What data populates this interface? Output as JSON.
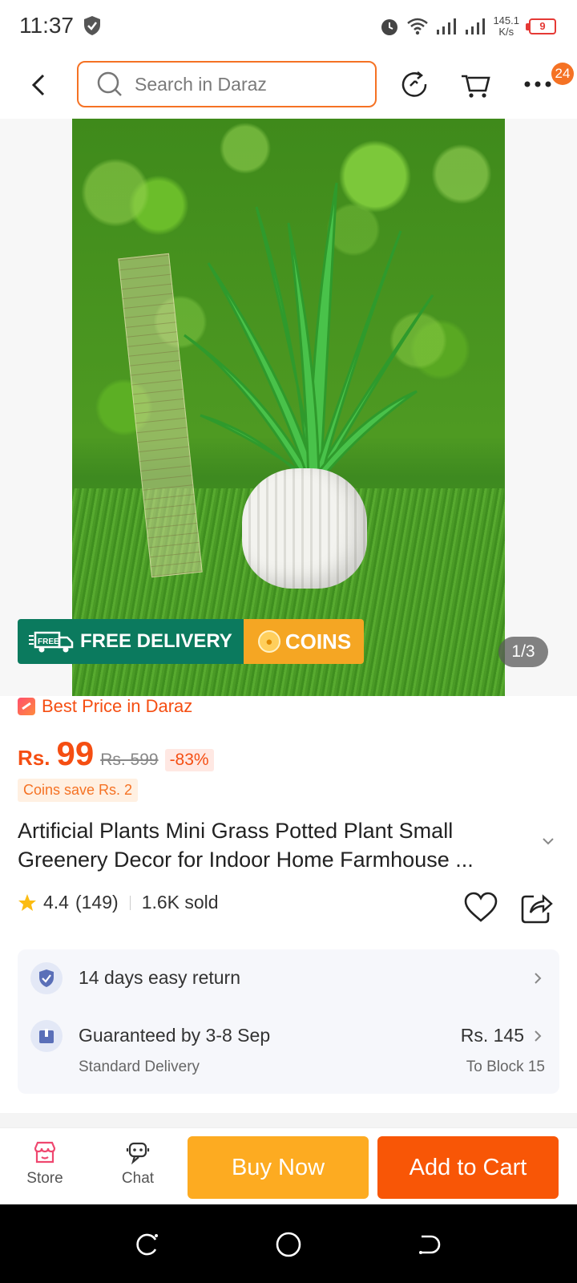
{
  "status_bar": {
    "time": "11:37",
    "net_speed_value": "145.1",
    "net_speed_unit": "K/s",
    "battery": "9"
  },
  "header": {
    "search_placeholder": "Search in Daraz",
    "more_badge": "24"
  },
  "gallery": {
    "badge_free_delivery": "FREE DELIVERY",
    "badge_free_tag": "FREE",
    "badge_coins": "COINS",
    "pager": "1/3"
  },
  "product": {
    "best_price": "Best Price in Daraz",
    "currency": "Rs.",
    "price": "99",
    "old_price": "Rs. 599",
    "discount": "-83%",
    "coins_save": "Coins save Rs. 2",
    "title": "Artificial Plants Mini Grass Potted Plant Small Greenery Decor for Indoor Home Farmhouse ...",
    "rating": "4.4",
    "rating_count": "(149)",
    "sold": "1.6K sold"
  },
  "services": {
    "return_text": "14 days easy return",
    "delivery_text": "Guaranteed by 3-8 Sep",
    "delivery_type": "Standard Delivery",
    "delivery_price": "Rs. 145",
    "delivery_location": "To Block 15"
  },
  "actions": {
    "store": "Store",
    "chat": "Chat",
    "buy_now": "Buy Now",
    "add_to_cart": "Add to Cart"
  },
  "colors": {
    "accent": "#f57224",
    "buy_now": "#fdab21",
    "add_to_cart": "#f85606",
    "delivery_badge": "#0b7a5e"
  }
}
